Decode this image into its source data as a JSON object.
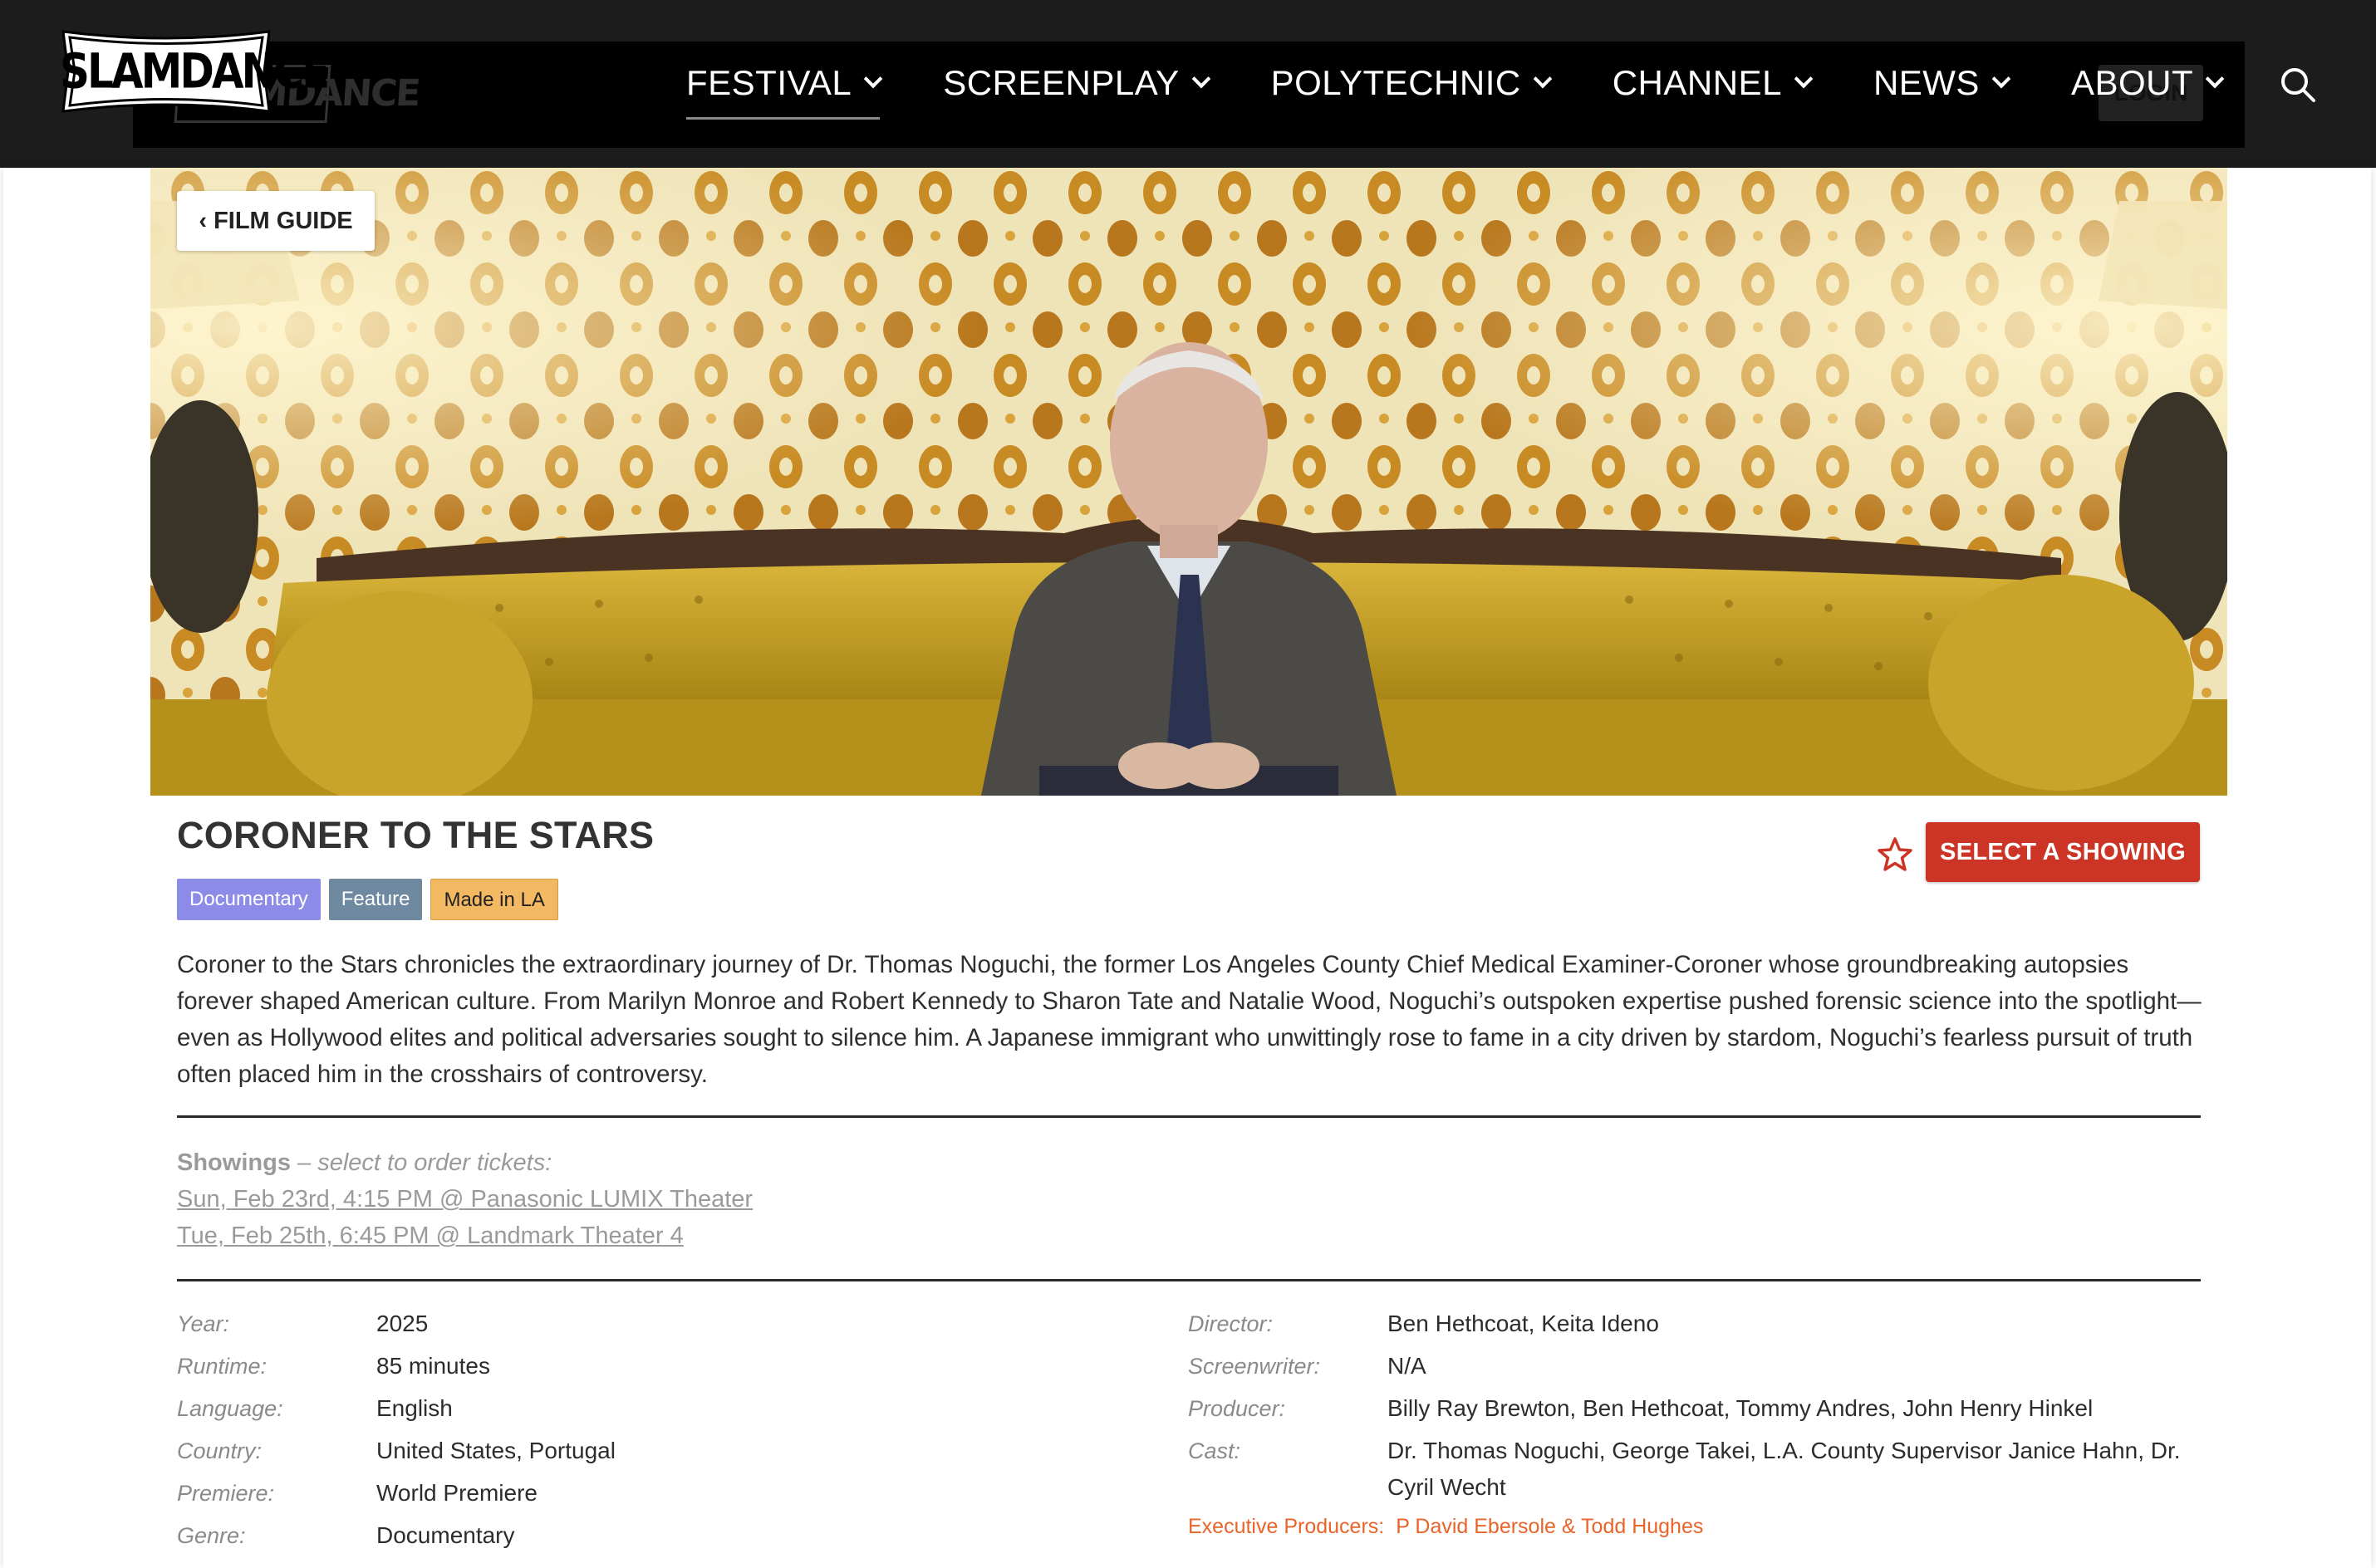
{
  "brand": {
    "logo_text": "SLAMDANCE",
    "ghost_login": "LOGIN"
  },
  "nav": {
    "items": [
      {
        "label": "FESTIVAL"
      },
      {
        "label": "SCREENPLAY"
      },
      {
        "label": "POLYTECHNIC"
      },
      {
        "label": "CHANNEL"
      },
      {
        "label": "NEWS"
      },
      {
        "label": "ABOUT"
      }
    ],
    "active": "FESTIVAL",
    "search_icon": "search-icon"
  },
  "page": {
    "back_label": "‹ FILM GUIDE",
    "title": "CORONER TO THE STARS",
    "tags": [
      {
        "label": "Documentary",
        "color": "#8c8ce8"
      },
      {
        "label": "Feature",
        "color": "#6f8aa0"
      },
      {
        "label": "Made in LA",
        "color": "#f3b862"
      }
    ],
    "favorite_icon": "star-outline-icon",
    "select_showing_label": "SELECT A SHOWING",
    "accent_color": "#cc3526",
    "synopsis": "Coroner to the Stars chronicles the extraordinary journey of Dr. Thomas Noguchi, the former Los Angeles County Chief Medical Examiner-Coroner whose groundbreaking autopsies forever shaped American culture. From Marilyn Monroe and Robert Kennedy to Sharon Tate and Natalie Wood, Noguchi’s outspoken expertise pushed forensic science into the spotlight—even as Hollywood elites and political adversaries sought to silence him. A Japanese immigrant who unwittingly rose to fame in a city driven by stardom, Noguchi’s fearless pursuit of truth often placed him in the crosshairs of controversy."
  },
  "showings": {
    "label": "Showings",
    "hint": " – select to order tickets:",
    "items": [
      "Sun, Feb 23rd, 4:15 PM @ Panasonic LUMIX Theater",
      "Tue, Feb 25th, 6:45 PM @ Landmark Theater 4"
    ]
  },
  "details": {
    "left": [
      {
        "key": "Year:",
        "value": "2025"
      },
      {
        "key": "Runtime:",
        "value": "85 minutes"
      },
      {
        "key": "Language:",
        "value": "English"
      },
      {
        "key": "Country:",
        "value": "United States, Portugal"
      },
      {
        "key": "Premiere:",
        "value": "World Premiere"
      },
      {
        "key": "Genre:",
        "value": "Documentary"
      }
    ],
    "right": [
      {
        "key": "Director:",
        "value": "Ben Hethcoat, Keita Ideno"
      },
      {
        "key": "Screenwriter:",
        "value": "N/A"
      },
      {
        "key": "Producer:",
        "value": "Billy Ray Brewton, Ben Hethcoat, Tommy Andres, John Henry Hinkel"
      },
      {
        "key": "Cast:",
        "value": "Dr. Thomas Noguchi, George Takei, L.A. County Supervisor Janice Hahn, Dr. Cyril Wecht"
      }
    ],
    "exec_key": "Executive Producers:",
    "exec_value": "P David Ebersole & Todd Hughes",
    "exec_color": "#e8642a"
  }
}
